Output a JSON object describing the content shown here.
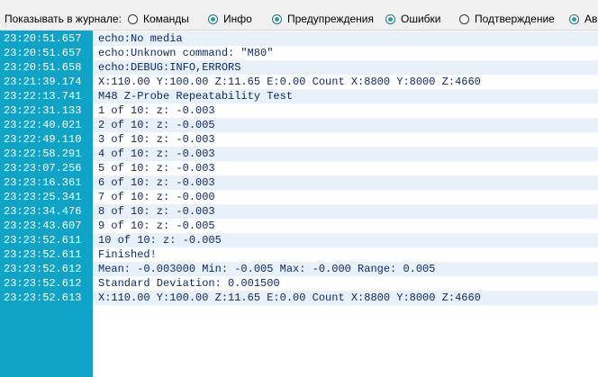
{
  "filter": {
    "label": "Показывать в журнале:",
    "options": [
      {
        "label": "Команды",
        "checked": false
      },
      {
        "label": "Инфо",
        "checked": true
      },
      {
        "label": "Предупреждения",
        "checked": true
      },
      {
        "label": "Ошибки",
        "checked": true
      },
      {
        "label": "Подтверждение",
        "checked": false
      },
      {
        "label": "Ав",
        "checked": true
      }
    ]
  },
  "log": {
    "rows": [
      {
        "ts": "23:20:51.657",
        "msg": "echo:No media"
      },
      {
        "ts": "23:20:51.657",
        "msg": "echo:Unknown command: \"M80\""
      },
      {
        "ts": "23:20:51.658",
        "msg": "echo:DEBUG:INFO,ERRORS"
      },
      {
        "ts": "23:21:39.174",
        "msg": "X:110.00 Y:100.00 Z:11.65 E:0.00 Count X:8800 Y:8000 Z:4660"
      },
      {
        "ts": "23:22:13.741",
        "msg": "M48 Z-Probe Repeatability Test"
      },
      {
        "ts": "23:22:31.133",
        "msg": "1 of 10: z: -0.003"
      },
      {
        "ts": "23:22:40.021",
        "msg": "2 of 10: z: -0.005"
      },
      {
        "ts": "23:22:49.110",
        "msg": "3 of 10: z: -0.003"
      },
      {
        "ts": "23:22:58.291",
        "msg": "4 of 10: z: -0.003"
      },
      {
        "ts": "23:23:07.256",
        "msg": "5 of 10: z: -0.003"
      },
      {
        "ts": "23:23:16.361",
        "msg": "6 of 10: z: -0.003"
      },
      {
        "ts": "23:23:25.341",
        "msg": "7 of 10: z: -0.000"
      },
      {
        "ts": "23:23:34.476",
        "msg": "8 of 10: z: -0.003"
      },
      {
        "ts": "23:23:43.607",
        "msg": "9 of 10: z: -0.005"
      },
      {
        "ts": "23:23:52.611",
        "msg": "10 of 10: z: -0.005"
      },
      {
        "ts": "23:23:52.611",
        "msg": "Finished!"
      },
      {
        "ts": "23:23:52.612",
        "msg": "Mean: -0.003000 Min: -0.005 Max: -0.000 Range: 0.005"
      },
      {
        "ts": "23:23:52.612",
        "msg": "Standard Deviation: 0.001500"
      },
      {
        "ts": "23:23:52.613",
        "msg": "X:110.00 Y:100.00 Z:11.65 E:0.00 Count X:8800 Y:8000 Z:4660"
      }
    ]
  },
  "colors": {
    "timestamp_column": "#0fa3c8",
    "message_text": "#0b2a6a",
    "alt_row": "#e8f0fa",
    "radio_checked": "#1aa3b8"
  }
}
